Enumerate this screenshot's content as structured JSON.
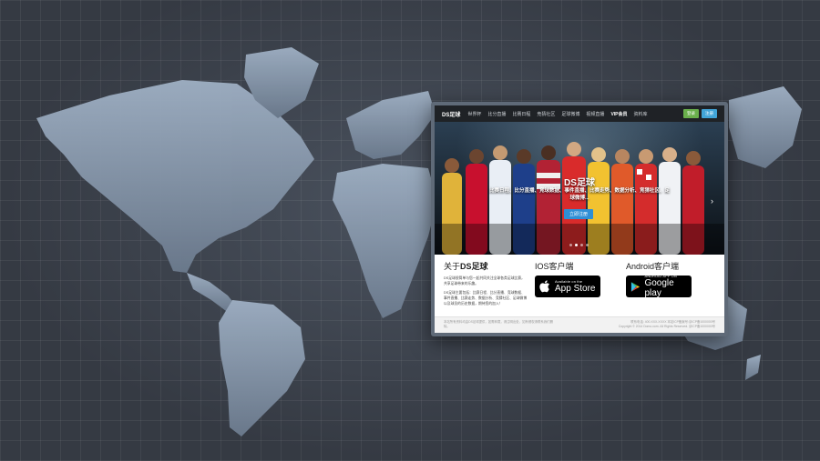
{
  "nav": {
    "brand": "DS足球",
    "items": [
      "世界杯",
      "比分直播",
      "比赛日程",
      "竞猜社区",
      "足球微博",
      "视频直播",
      "VIP会员",
      "资料库"
    ],
    "login_label": "登录",
    "register_label": "注册"
  },
  "hero": {
    "title": "DS足球",
    "subtitle": "比赛日程、比分直播、竞球数据、事件直播、比赛走势、数据分析、竞猜社区、足球微博...",
    "cta_label": "立即注册",
    "next_arrow": "›",
    "slide_count": 4,
    "active_slide": 2
  },
  "about": {
    "title_prefix": "关于",
    "title_bold": "DS足球",
    "paragraph1": "DS足球很简单与您一起共同关注全球各类足球比赛，共享足球带来的乐趣。",
    "paragraph2": "DS足球主要包括：比赛日程、比分直播、竞球数据、事件直播、比赛走势、数据分析、竞猜社区、足球微博以及球员的历史数据，期待您的加入！"
  },
  "ios": {
    "title": "IOS客户端",
    "store_small": "Available on the",
    "store_big": "App Store"
  },
  "android": {
    "title": "Android客户端",
    "store_small": "ANDROID APP ON",
    "store_big": "Google play"
  },
  "footer": {
    "left": "本站所有资料均由DS足球提供，如需转载，请注明出处，如有侵权请联系我们删除。",
    "right_line1": "联系电话: 400-XXX-XXXX 本站ICP备案号:京ICP备1000000号",
    "right_line2": "Copyright © 2014 Domo.com. All Rights Reserved. 京ICP备1000000号"
  }
}
